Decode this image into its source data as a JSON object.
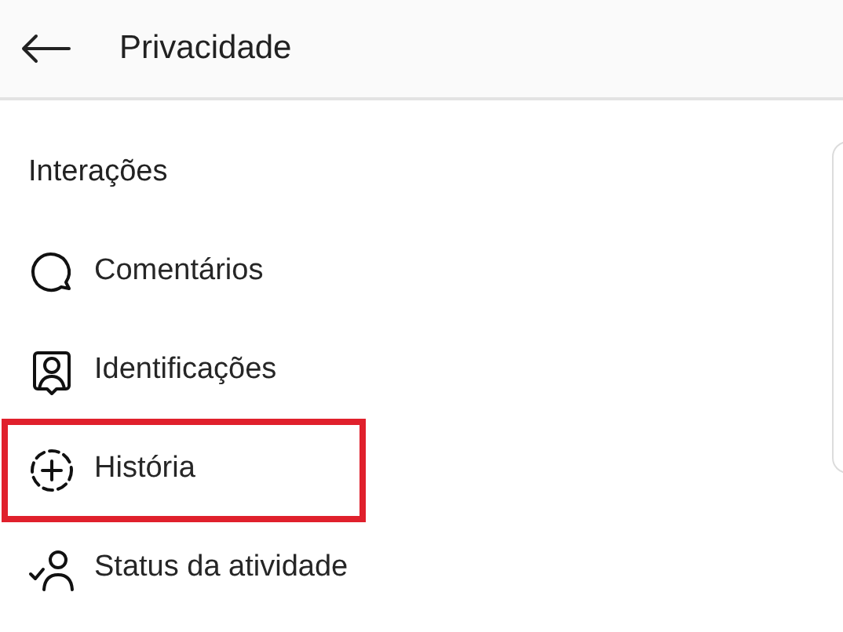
{
  "header": {
    "title": "Privacidade"
  },
  "section": {
    "title": "Interações"
  },
  "items": [
    {
      "kind": "comment",
      "label": "Comentários",
      "highlighted": false
    },
    {
      "kind": "tag",
      "label": "Identificações",
      "highlighted": false
    },
    {
      "kind": "story",
      "label": "História",
      "highlighted": true
    },
    {
      "kind": "activity",
      "label": "Status da atividade",
      "highlighted": false
    }
  ]
}
